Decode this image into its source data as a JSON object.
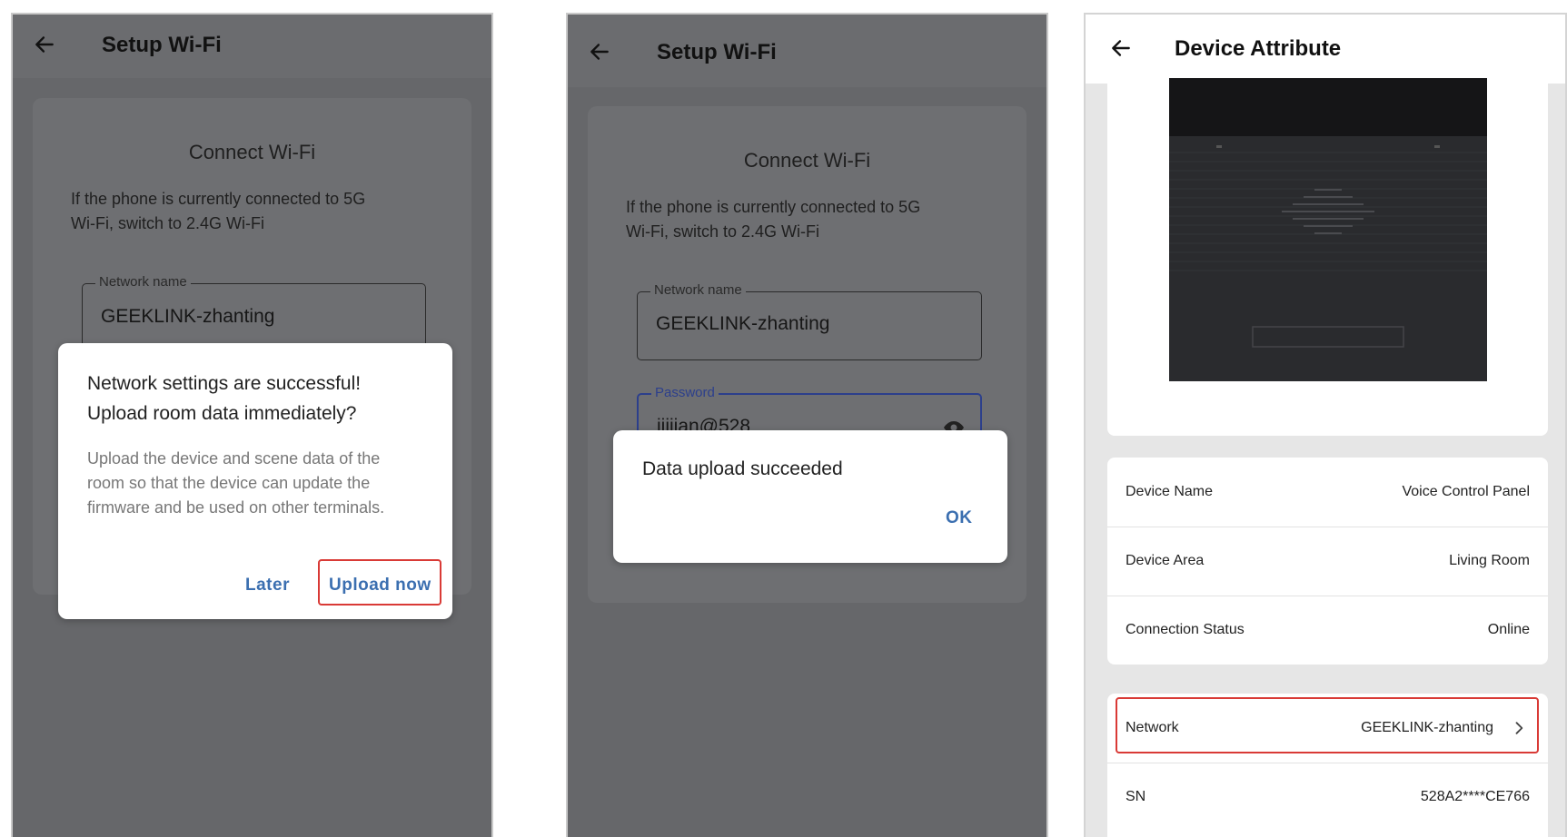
{
  "screen1": {
    "header": {
      "title": "Setup Wi-Fi"
    },
    "card": {
      "title": "Connect Wi-Fi",
      "description_line1": "If the phone is currently connected to 5G",
      "description_line2": "Wi-Fi, switch to 2.4G Wi-Fi",
      "network_label": "Network name",
      "network_value": "GEEKLINK-zhanting"
    },
    "dialog": {
      "title_line1": "Network settings are successful!",
      "title_line2": "Upload room data immediately?",
      "body_line1": "Upload the device and scene data of the",
      "body_line2": "room so that the device can update the",
      "body_line3": "firmware and be used on other terminals.",
      "later_label": "Later",
      "upload_label": "Upload now"
    }
  },
  "screen2": {
    "header": {
      "title": "Setup Wi-Fi"
    },
    "card": {
      "title": "Connect Wi-Fi",
      "description_line1": "If the phone is currently connected to 5G",
      "description_line2": "Wi-Fi, switch to 2.4G Wi-Fi",
      "network_label": "Network name",
      "network_value": "GEEKLINK-zhanting",
      "password_label": "Password",
      "password_value": "jiijian@528"
    },
    "dialog": {
      "message": "Data upload succeeded",
      "ok_label": "OK"
    }
  },
  "screen3": {
    "header": {
      "title": "Device Attribute"
    },
    "rows_group1": [
      {
        "label": "Device Name",
        "value": "Voice Control Panel"
      },
      {
        "label": "Device Area",
        "value": "Living Room"
      },
      {
        "label": "Connection Status",
        "value": "Online"
      }
    ],
    "rows_group2": [
      {
        "label": "Network",
        "value": "GEEKLINK-zhanting"
      },
      {
        "label": "SN",
        "value": "528A2****CE766"
      }
    ]
  },
  "colors": {
    "accent_blue": "#3b6fb0",
    "highlight_red": "#d93a36",
    "scrim_gray": "#66676a"
  },
  "icons": [
    "back-arrow-icon",
    "eye-icon",
    "chevron-right-icon"
  ]
}
